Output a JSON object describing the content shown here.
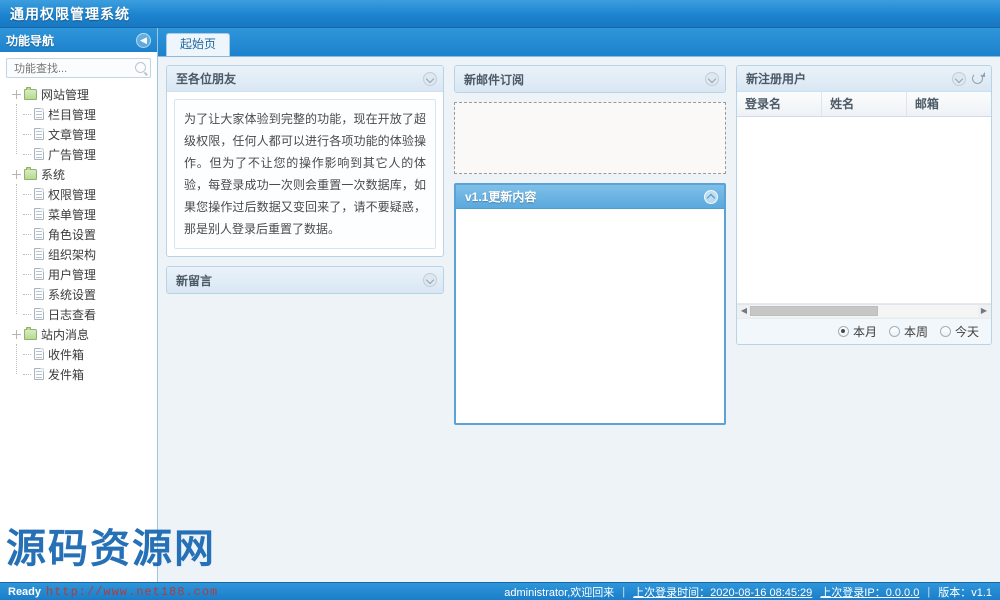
{
  "app": {
    "title": "通用权限管理系统"
  },
  "sidebar": {
    "header_title": "功能导航",
    "collapse_icon": "chevron-left-icon",
    "search_placeholder": "功能查找...",
    "tree": [
      {
        "label": "网站管理",
        "level": 0,
        "icon": "folder-icon"
      },
      {
        "label": "栏目管理",
        "level": 1,
        "icon": "page-icon"
      },
      {
        "label": "文章管理",
        "level": 1,
        "icon": "page-icon"
      },
      {
        "label": "广告管理",
        "level": 1,
        "icon": "page-icon"
      },
      {
        "label": "系统",
        "level": 0,
        "icon": "folder-icon"
      },
      {
        "label": "权限管理",
        "level": 1,
        "icon": "page-icon"
      },
      {
        "label": "菜单管理",
        "level": 1,
        "icon": "page-icon"
      },
      {
        "label": "角色设置",
        "level": 1,
        "icon": "page-icon"
      },
      {
        "label": "组织架构",
        "level": 1,
        "icon": "page-icon"
      },
      {
        "label": "用户管理",
        "level": 1,
        "icon": "page-icon"
      },
      {
        "label": "系统设置",
        "level": 1,
        "icon": "page-icon"
      },
      {
        "label": "日志查看",
        "level": 1,
        "icon": "page-icon"
      },
      {
        "label": "站内消息",
        "level": 0,
        "icon": "folder-icon"
      },
      {
        "label": "收件箱",
        "level": 1,
        "icon": "page-icon"
      },
      {
        "label": "发件箱",
        "level": 1,
        "icon": "page-icon"
      }
    ]
  },
  "tabs": [
    {
      "label": "起始页",
      "active": true
    }
  ],
  "portlets": {
    "welcome": {
      "title": "至各位朋友",
      "collapse_icon": "chevron-down-icon",
      "body": "为了让大家体验到完整的功能，现在开放了超级权限，任何人都可以进行各项功能的体验操作。但为了不让您的操作影响到其它人的体验，每登录成功一次则会重置一次数据库，如果您操作过后数据又变回来了，请不要疑惑，那是别人登录后重置了数据。"
    },
    "messages": {
      "title": "新留言",
      "collapse_icon": "chevron-down-icon"
    },
    "mail": {
      "title": "新邮件订阅",
      "collapse_icon": "chevron-down-icon"
    },
    "changelog": {
      "title": "v1.1更新内容",
      "collapse_icon": "chevron-up-icon"
    },
    "newusers": {
      "title": "新注册用户",
      "collapse_icon": "chevron-down-icon",
      "refresh_icon": "refresh-icon",
      "columns": [
        "登录名",
        "姓名",
        "邮箱"
      ],
      "rows": [],
      "filters": [
        {
          "label": "本月",
          "selected": true
        },
        {
          "label": "本周",
          "selected": false
        },
        {
          "label": "今天",
          "selected": false
        }
      ],
      "scroll_left_icon": "triangle-left-icon",
      "scroll_right_icon": "triangle-right-icon"
    }
  },
  "statusbar": {
    "ready": "Ready",
    "user_greeting": "administrator,欢迎回来",
    "last_login_time": "上次登录时间：2020-08-16 08:45:29",
    "last_login_ip": "上次登录IP：0.0.0.0",
    "version": "版本：v1.1",
    "sep": "|"
  },
  "watermark": {
    "text": "源码资源网",
    "url": "http://www.net188.com"
  },
  "colors": {
    "brand": "#1d86d2",
    "accent": "#5aa9dd",
    "panel_border": "#b9d3e6"
  }
}
